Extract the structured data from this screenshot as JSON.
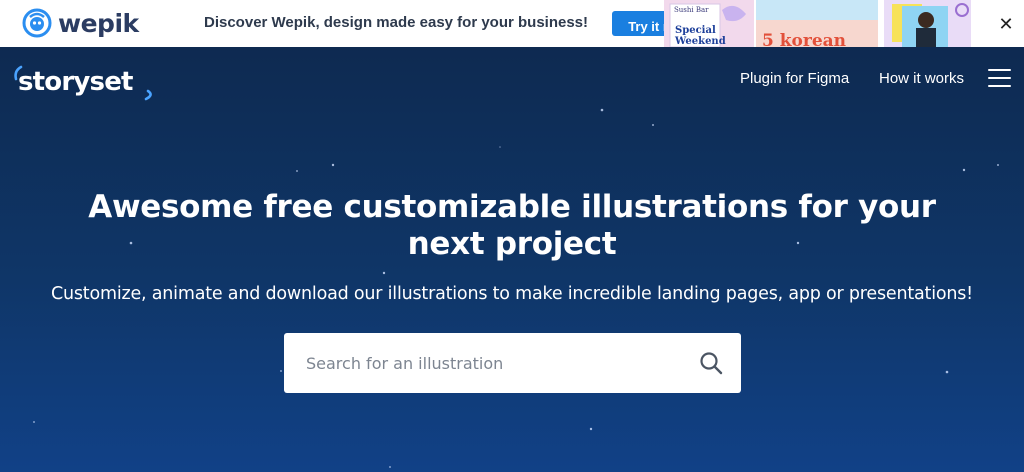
{
  "banner": {
    "brand": "wepik",
    "brand_icon": "wepik-mascot-icon",
    "message": "Discover Wepik, design made easy for your business!",
    "cta_label": "Try it n",
    "ad_texts": {
      "sushi": "Sushi Bar",
      "special": "Special",
      "weekend": "Weekend",
      "korean": "5 korean"
    },
    "close_icon": "close-icon",
    "close_glyph": "✕"
  },
  "nav": {
    "logo": "storyset",
    "links": [
      {
        "label": "Plugin for Figma"
      },
      {
        "label": "How it works"
      }
    ],
    "menu_icon": "hamburger-menu-icon"
  },
  "hero": {
    "headline": "Awesome free customizable illustrations for your next project",
    "subline": "Customize, animate and download our illustrations to make incredible landing pages, app or presentations!"
  },
  "search": {
    "placeholder": "Search for an illustration",
    "value": "",
    "icon": "search-icon"
  },
  "colors": {
    "hero_top": "#0e2a51",
    "hero_bottom": "#114187",
    "accent_blue": "#1a7fe0",
    "logo_accent": "#4aa3ff"
  }
}
